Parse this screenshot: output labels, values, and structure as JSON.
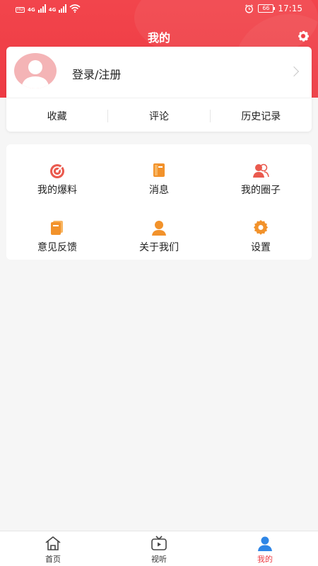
{
  "status_bar": {
    "network_left": "4G",
    "network_right": "4G",
    "battery": "66",
    "time": "17:15"
  },
  "header": {
    "title": "我的"
  },
  "profile": {
    "login_label": "登录/注册",
    "quick_links": [
      "收藏",
      "评论",
      "历史记录"
    ]
  },
  "menu": {
    "items": [
      {
        "label": "我的爆料",
        "icon": "target-icon"
      },
      {
        "label": "消息",
        "icon": "book-icon"
      },
      {
        "label": "我的圈子",
        "icon": "users-icon"
      },
      {
        "label": "意见反馈",
        "icon": "feedback-book-icon"
      },
      {
        "label": "关于我们",
        "icon": "person-icon"
      },
      {
        "label": "设置",
        "icon": "gear-icon"
      }
    ]
  },
  "tab_bar": {
    "tabs": [
      {
        "label": "首页",
        "icon": "home-icon"
      },
      {
        "label": "视听",
        "icon": "tv-icon"
      },
      {
        "label": "我的",
        "icon": "person-icon"
      }
    ],
    "active": "我的"
  },
  "colors": {
    "brand_red": "#ee3a43",
    "icon_orange": "#f2922b",
    "icon_red": "#ea5a4e",
    "active_blue": "#2f86e6"
  }
}
